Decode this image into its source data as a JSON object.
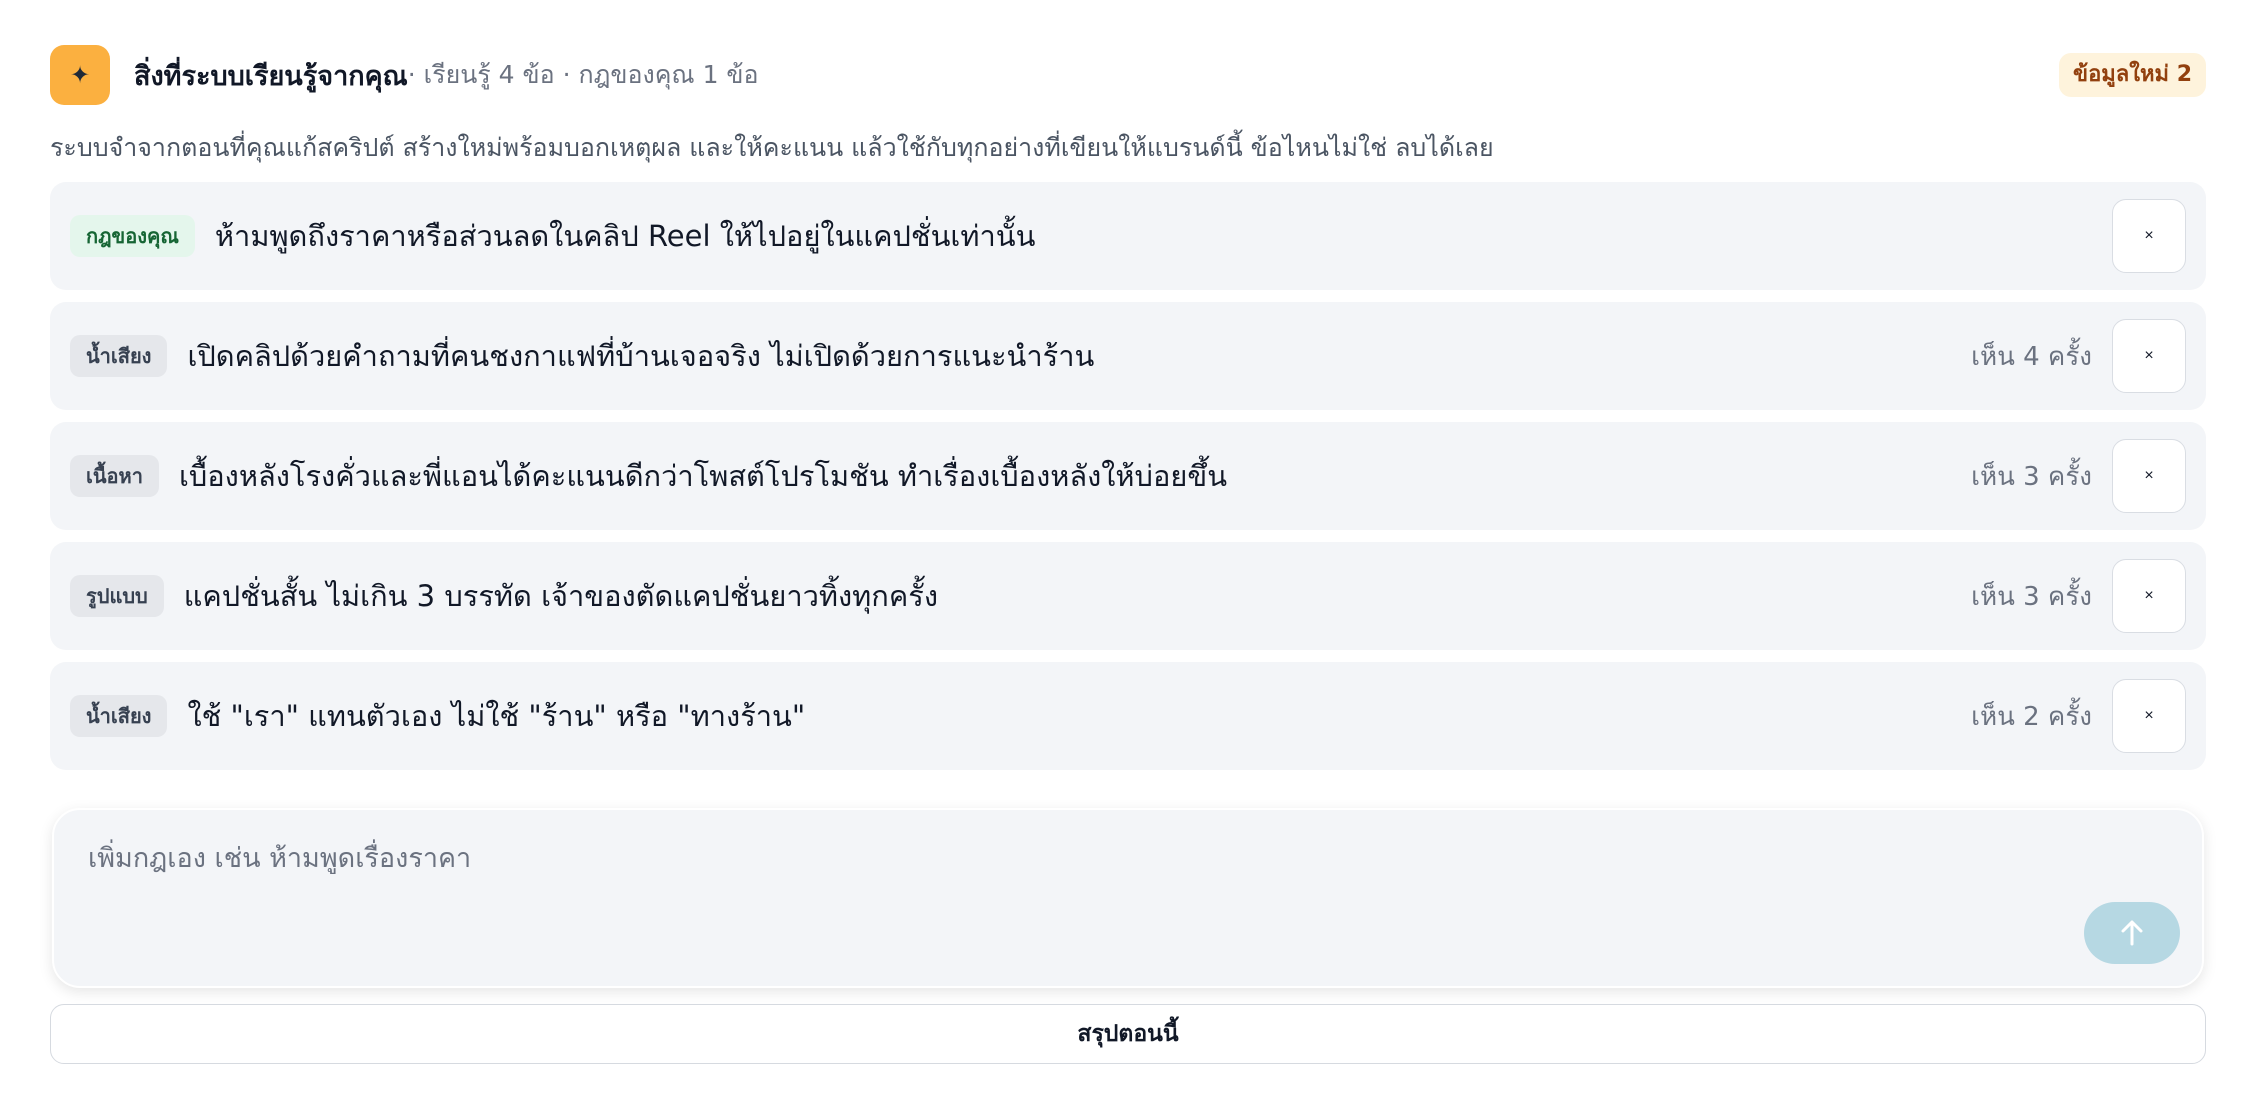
{
  "header": {
    "title": "สิ่งที่ระบบเรียนรู้จากคุณ",
    "meta": "· เรียนรู้ 4 ข้อ · กฎของคุณ 1 ข้อ",
    "badge": "ข้อมูลใหม่ 2",
    "icon": "sparkle-icon"
  },
  "description": "ระบบจำจากตอนที่คุณแก้สคริปต์ สร้างใหม่พร้อมบอกเหตุผล และให้คะแนน แล้วใช้กับทุกอย่างที่เขียนให้แบรนด์นี้ ข้อไหนไม่ใช่ ลบได้เลย",
  "rules": [
    {
      "tag": "กฎของคุณ",
      "text": "ห้ามพูดถึงราคาหรือส่วนลดในคลิป Reel ให้ไปอยู่ในแคปชั่นเท่านั้น",
      "seen": ""
    },
    {
      "tag": "น้ำเสียง",
      "text": "เปิดคลิปด้วยคำถามที่คนชงกาแฟที่บ้านเจอจริง ไม่เปิดด้วยการแนะนำร้าน",
      "seen": "เห็น 4 ครั้ง"
    },
    {
      "tag": "เนื้อหา",
      "text": "เบื้องหลังโรงคั่วและพี่แอนได้คะแนนดีกว่าโพสต์โปรโมชัน ทำเรื่องเบื้องหลังให้บ่อยขึ้น",
      "seen": "เห็น 3 ครั้ง"
    },
    {
      "tag": "รูปแบบ",
      "text": "แคปชั่นสั้น ไม่เกิน 3 บรรทัด เจ้าของตัดแคปชั่นยาวทิ้งทุกครั้ง",
      "seen": "เห็น 3 ครั้ง"
    },
    {
      "tag": "น้ำเสียง",
      "text": "ใช้ \"เรา\" แทนตัวเอง ไม่ใช้ \"ร้าน\" หรือ \"ทางร้าน\"",
      "seen": "เห็น 2 ครั้ง"
    }
  ],
  "remove_label": "×",
  "composer": {
    "placeholder": "เพิ่มกฎเอง เช่น ห้ามพูดเรื่องราคา",
    "value": "",
    "send_icon": "arrow-up-icon"
  },
  "summary_button": "สรุปตอนนี้",
  "colors": {
    "accent": "#fbb040",
    "badge_bg": "#fef3dc",
    "rule_tag_bg": "#e4f6ec",
    "row_bg": "#f3f5f8",
    "send_bg": "#b6d8e3"
  }
}
